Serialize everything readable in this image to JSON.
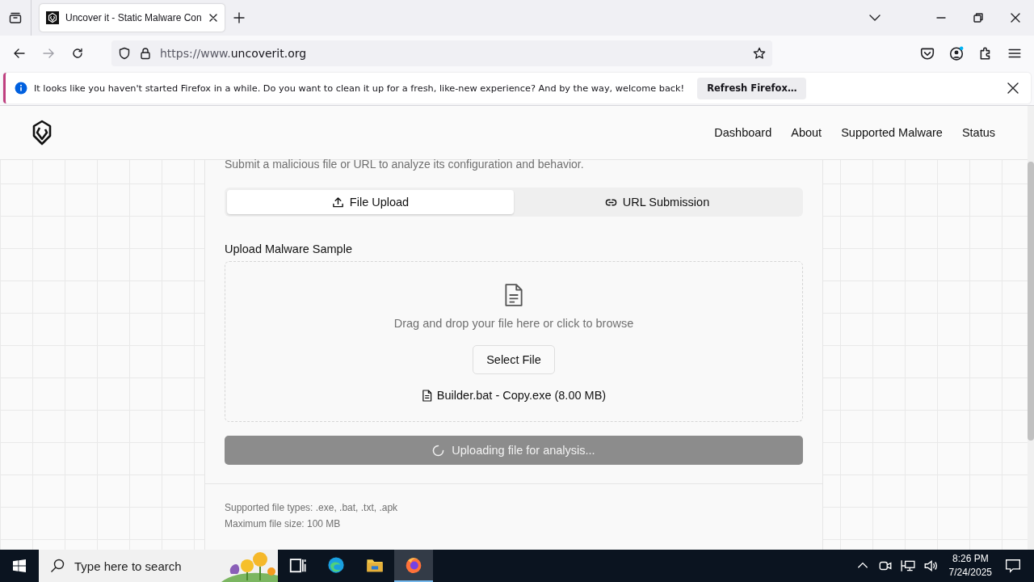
{
  "browser": {
    "tab_title": "Uncover it - Static Malware Con",
    "url_prefix": "https://www.",
    "url_domain": "uncoverit.org"
  },
  "notification": {
    "message": "It looks like you haven't started Firefox in a while. Do you want to clean it up for a fresh, like-new experience? And by the way, welcome back!",
    "button": "Refresh Firefox…"
  },
  "site": {
    "nav": [
      {
        "label": "Dashboard"
      },
      {
        "label": "About"
      },
      {
        "label": "Supported Malware"
      },
      {
        "label": "Status"
      }
    ]
  },
  "card": {
    "subtitle": "Submit a malicious file or URL to analyze its configuration and behavior.",
    "tabs": [
      {
        "label": "File Upload",
        "kind": "upload",
        "selected": true
      },
      {
        "label": "URL Submission",
        "kind": "link",
        "selected": false
      }
    ],
    "upload_label": "Upload Malware Sample",
    "dropzone_text": "Drag and drop your file here or click to browse",
    "select_button": "Select File",
    "file_name": "Builder.bat - Copy.exe (8.00 MB)",
    "submit": {
      "label": "Uploading file for analysis...",
      "disabled": true
    },
    "notes": [
      "Supported file types: .exe, .bat, .txt, .apk",
      "Maximum file size: 100 MB"
    ]
  },
  "taskbar": {
    "search_placeholder": "Type here to search",
    "apps": [
      {
        "kind": "task-view",
        "active": false
      },
      {
        "kind": "edge",
        "active": false
      },
      {
        "kind": "explorer",
        "active": false
      },
      {
        "kind": "firefox",
        "active": true
      }
    ],
    "time": "8:26 PM",
    "date": "7/24/2025"
  }
}
